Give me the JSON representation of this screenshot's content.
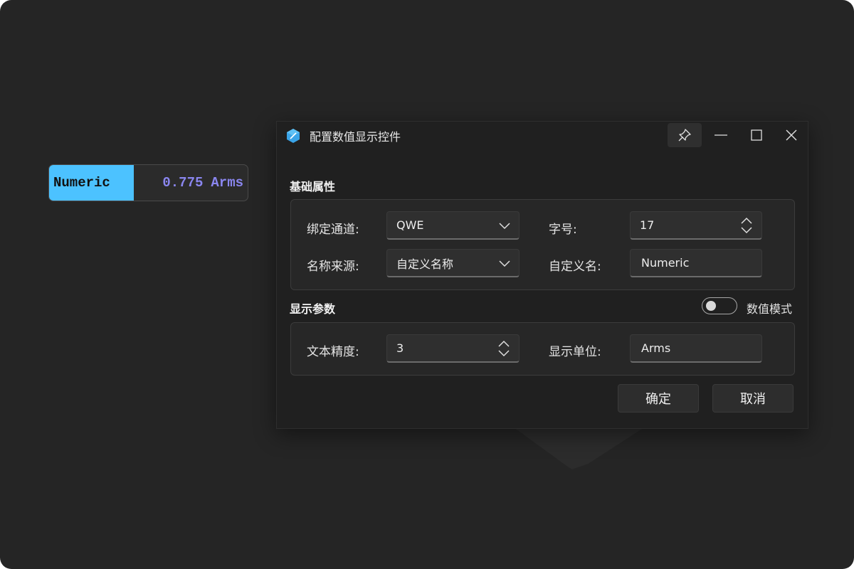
{
  "numeric_widget": {
    "name": "Numeric",
    "value": "0.775",
    "unit": "Arms",
    "name_bg_color": "#4cc2ff",
    "value_color": "#8a86ef"
  },
  "dialog": {
    "title": "配置数值显示控件",
    "app_icon": "app-hex-icon",
    "titlebar_buttons": [
      "pin-icon",
      "minimize-icon",
      "maximize-icon",
      "close-icon"
    ],
    "basic_section": {
      "title": "基础属性",
      "channel_label": "绑定通道:",
      "channel_value": "QWE",
      "font_size_label": "字号:",
      "font_size_value": "17",
      "name_source_label": "名称来源:",
      "name_source_value": "自定义名称",
      "custom_name_label": "自定义名:",
      "custom_name_value": "Numeric"
    },
    "display_section": {
      "title": "显示参数",
      "value_mode_label": "数值模式",
      "value_mode_on": false,
      "precision_label": "文本精度:",
      "precision_value": "3",
      "unit_label": "显示单位:",
      "unit_value": "Arms"
    },
    "buttons": {
      "ok": "确定",
      "cancel": "取消"
    }
  }
}
